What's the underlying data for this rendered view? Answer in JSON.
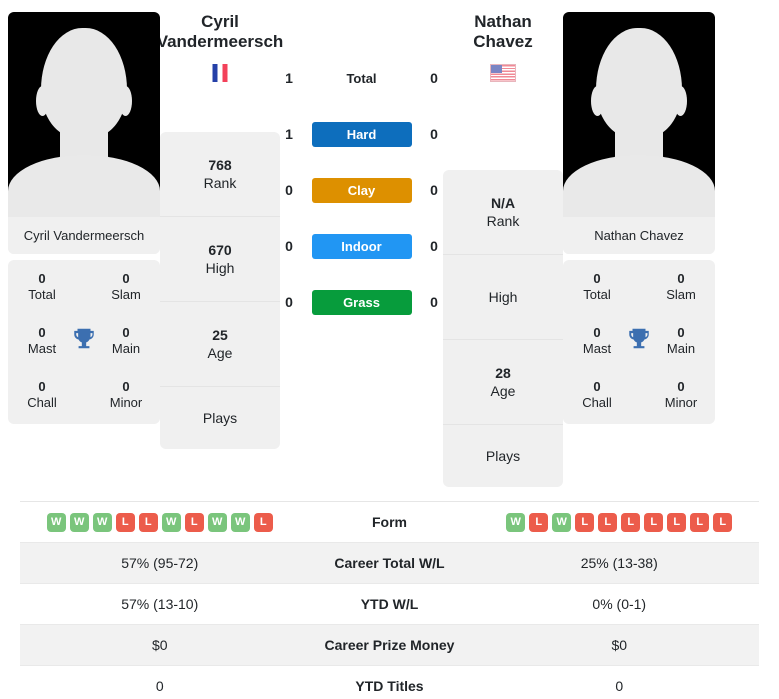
{
  "players": {
    "left": {
      "first_name": "Cyril",
      "last_name": "Vandermeersch",
      "full_name": "Cyril Vandermeersch",
      "flag": "flag-fr",
      "rank": "768",
      "rank_label": "Rank",
      "high": "670",
      "high_label": "High",
      "age": "25",
      "age_label": "Age",
      "plays_label": "Plays",
      "plays_value": "",
      "titles": {
        "total": "0",
        "total_label": "Total",
        "slam": "0",
        "slam_label": "Slam",
        "mast": "0",
        "mast_label": "Mast",
        "main": "0",
        "main_label": "Main",
        "chall": "0",
        "chall_label": "Chall",
        "minor": "0",
        "minor_label": "Minor"
      },
      "form": [
        "W",
        "W",
        "W",
        "L",
        "L",
        "W",
        "L",
        "W",
        "W",
        "L"
      ],
      "career_wl": "57% (95-72)",
      "ytd_wl": "57% (13-10)",
      "career_prize": "$0",
      "ytd_titles": "0"
    },
    "right": {
      "first_name": "Nathan",
      "last_name": "Chavez",
      "full_name": "Nathan Chavez",
      "flag": "flag-us",
      "rank": "N/A",
      "rank_label": "Rank",
      "high": "",
      "high_label": "High",
      "age": "28",
      "age_label": "Age",
      "plays_label": "Plays",
      "plays_value": "",
      "titles": {
        "total": "0",
        "total_label": "Total",
        "slam": "0",
        "slam_label": "Slam",
        "mast": "0",
        "mast_label": "Mast",
        "main": "0",
        "main_label": "Main",
        "chall": "0",
        "chall_label": "Chall",
        "minor": "0",
        "minor_label": "Minor"
      },
      "form": [
        "W",
        "L",
        "W",
        "L",
        "L",
        "L",
        "L",
        "L",
        "L",
        "L"
      ],
      "career_wl": "25% (13-38)",
      "ytd_wl": "0% (0-1)",
      "career_prize": "$0",
      "ytd_titles": "0"
    }
  },
  "h2h": {
    "total": {
      "label": "Total",
      "left": "1",
      "right": "0"
    },
    "surfaces": [
      {
        "label": "Hard",
        "left": "1",
        "right": "0",
        "color": "#0d6ebd"
      },
      {
        "label": "Clay",
        "left": "0",
        "right": "0",
        "color": "#dd9000"
      },
      {
        "label": "Indoor",
        "left": "0",
        "right": "0",
        "color": "#2196f3"
      },
      {
        "label": "Grass",
        "left": "0",
        "right": "0",
        "color": "#079c3c"
      }
    ]
  },
  "stats_rows": {
    "form_label": "Form",
    "career_wl_label": "Career Total W/L",
    "ytd_wl_label": "YTD W/L",
    "career_prize_label": "Career Prize Money",
    "ytd_titles_label": "YTD Titles"
  },
  "colors": {
    "panel_bg": "#f0f0f0",
    "row_alt_bg": "#f2f2f2",
    "win_badge": "#7ac57c",
    "loss_badge": "#ec5c4b",
    "trophy": "#3c6fb0"
  }
}
